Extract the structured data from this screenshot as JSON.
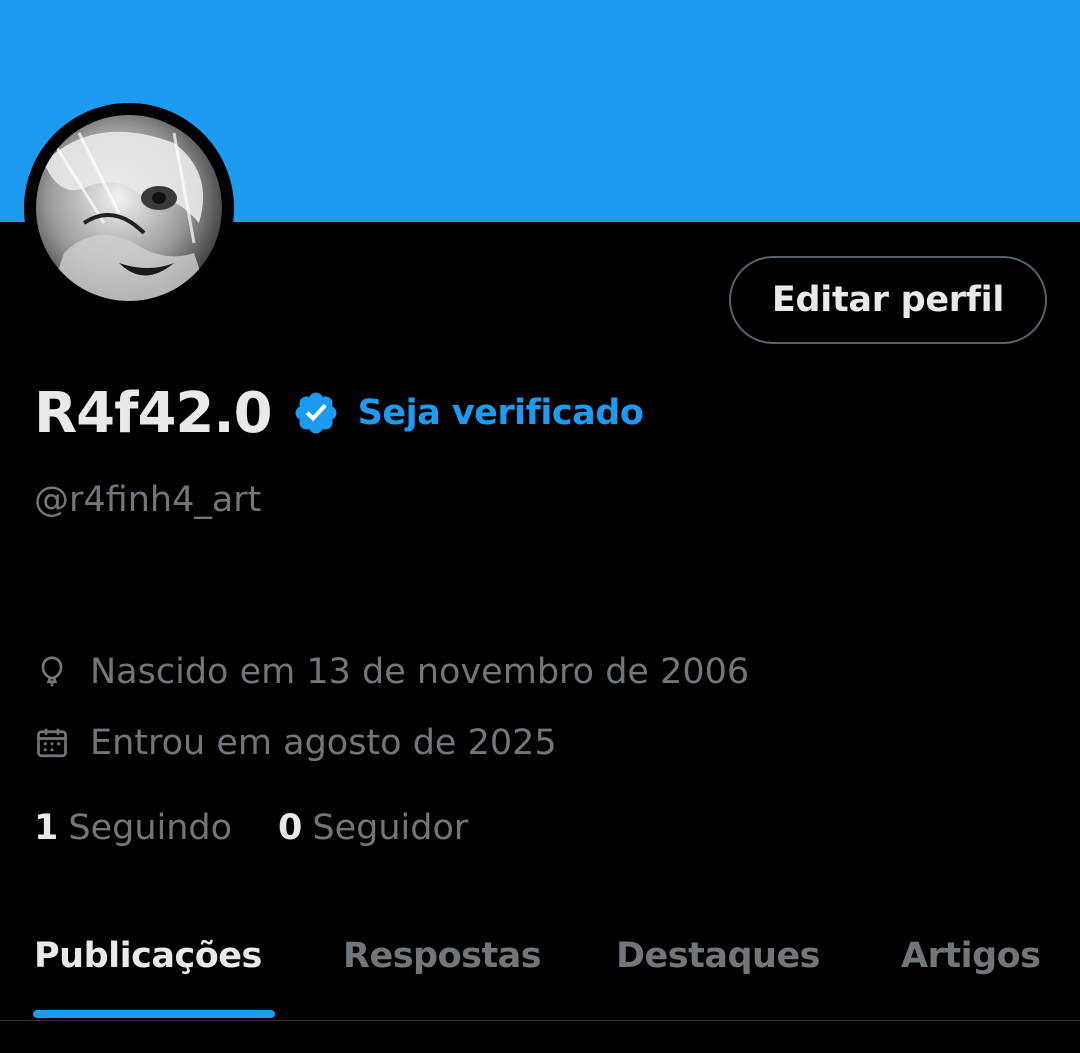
{
  "colors": {
    "banner": "#1d9bf0",
    "background": "#000000",
    "accent": "#1d9bf0",
    "primary_text": "#e7e9ea",
    "secondary_text": "#71767b",
    "border": "#536471"
  },
  "profile": {
    "display_name": "R4f42.0",
    "handle": "@r4finh4_art",
    "verified_icon": "verified-badge-icon",
    "get_verified_label": "Seja verificado",
    "edit_profile_label": "Editar perfil",
    "birth": {
      "icon": "balloon-icon",
      "text": "Nascido em 13 de novembro de 2006"
    },
    "joined": {
      "icon": "calendar-icon",
      "text": "Entrou em agosto de 2025"
    },
    "following": {
      "count": "1",
      "label": "Seguindo"
    },
    "followers": {
      "count": "0",
      "label": "Seguidor"
    }
  },
  "tabs": [
    {
      "label": "Publicações",
      "active": true
    },
    {
      "label": "Respostas",
      "active": false
    },
    {
      "label": "Destaques",
      "active": false
    },
    {
      "label": "Artigos",
      "active": false
    }
  ]
}
